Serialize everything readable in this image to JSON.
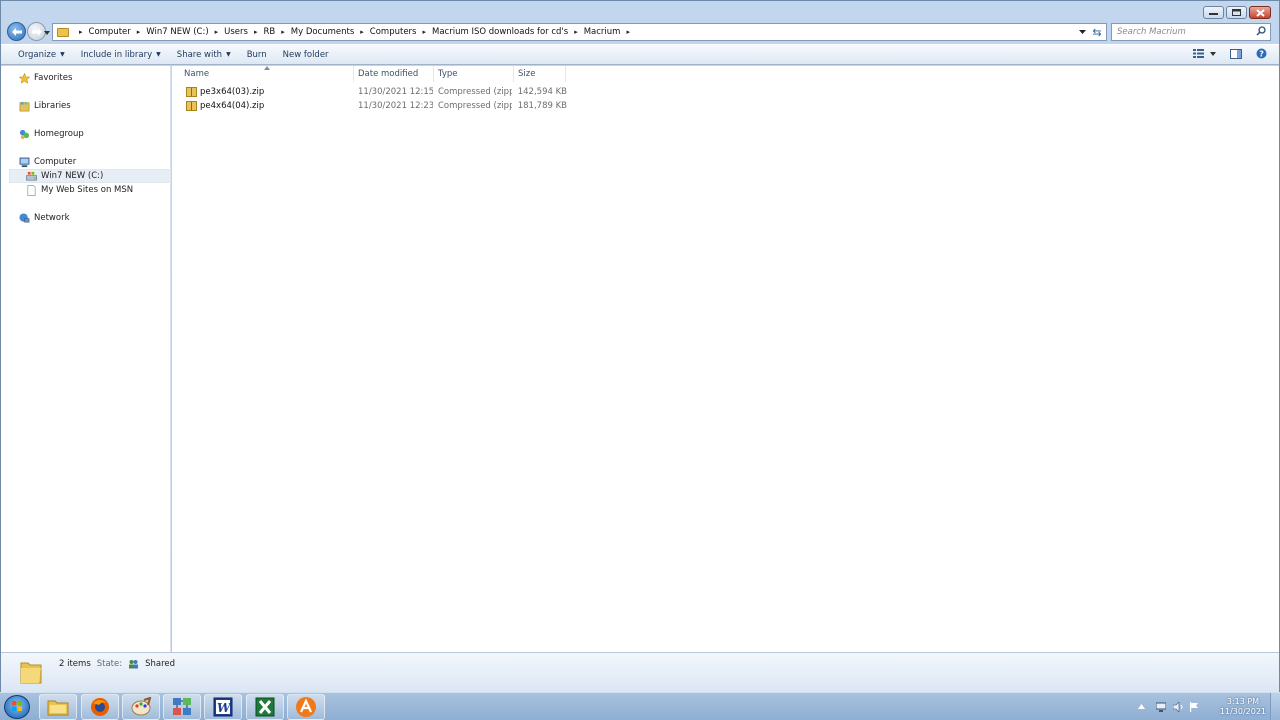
{
  "window": {
    "caption_buttons": {
      "minimize": "minimize-icon",
      "maximize": "maximize-icon",
      "close": "close-icon"
    }
  },
  "address": {
    "crumbs": [
      "Computer",
      "Win7 NEW (C:)",
      "Users",
      "RB",
      "My Documents",
      "Computers",
      "Macrium ISO downloads for cd's",
      "Macrium"
    ]
  },
  "search": {
    "placeholder": "Search Macrium"
  },
  "toolbar": {
    "organize": "Organize",
    "include_in_library": "Include in library",
    "share_with": "Share with",
    "burn": "Burn",
    "new_folder": "New folder"
  },
  "nav": {
    "favorites": "Favorites",
    "libraries": "Libraries",
    "homegroup": "Homegroup",
    "computer": "Computer",
    "drive_c": "Win7 NEW (C:)",
    "my_web_sites": "My Web Sites on MSN",
    "network": "Network"
  },
  "columns": {
    "name": "Name",
    "date_modified": "Date modified",
    "type": "Type",
    "size": "Size"
  },
  "files": [
    {
      "name": "pe3x64(03).zip",
      "date": "11/30/2021 12:15 ...",
      "type": "Compressed (zipp...",
      "size": "142,594 KB"
    },
    {
      "name": "pe4x64(04).zip",
      "date": "11/30/2021 12:23 ...",
      "type": "Compressed (zipp...",
      "size": "181,789 KB"
    }
  ],
  "details": {
    "count": "2 items",
    "state_label": "State:",
    "state_value": "Shared"
  },
  "taskbar": {
    "apps": [
      "explorer-icon",
      "firefox-icon",
      "paint-icon",
      "network-app-icon",
      "word-icon",
      "excel-icon",
      "avast-icon"
    ],
    "time": "3:13 PM",
    "date": "11/30/2021"
  },
  "colors": {
    "accent": "#2c6cb5",
    "toolbar_text": "#1e395b",
    "selection": "#e8eef6"
  }
}
